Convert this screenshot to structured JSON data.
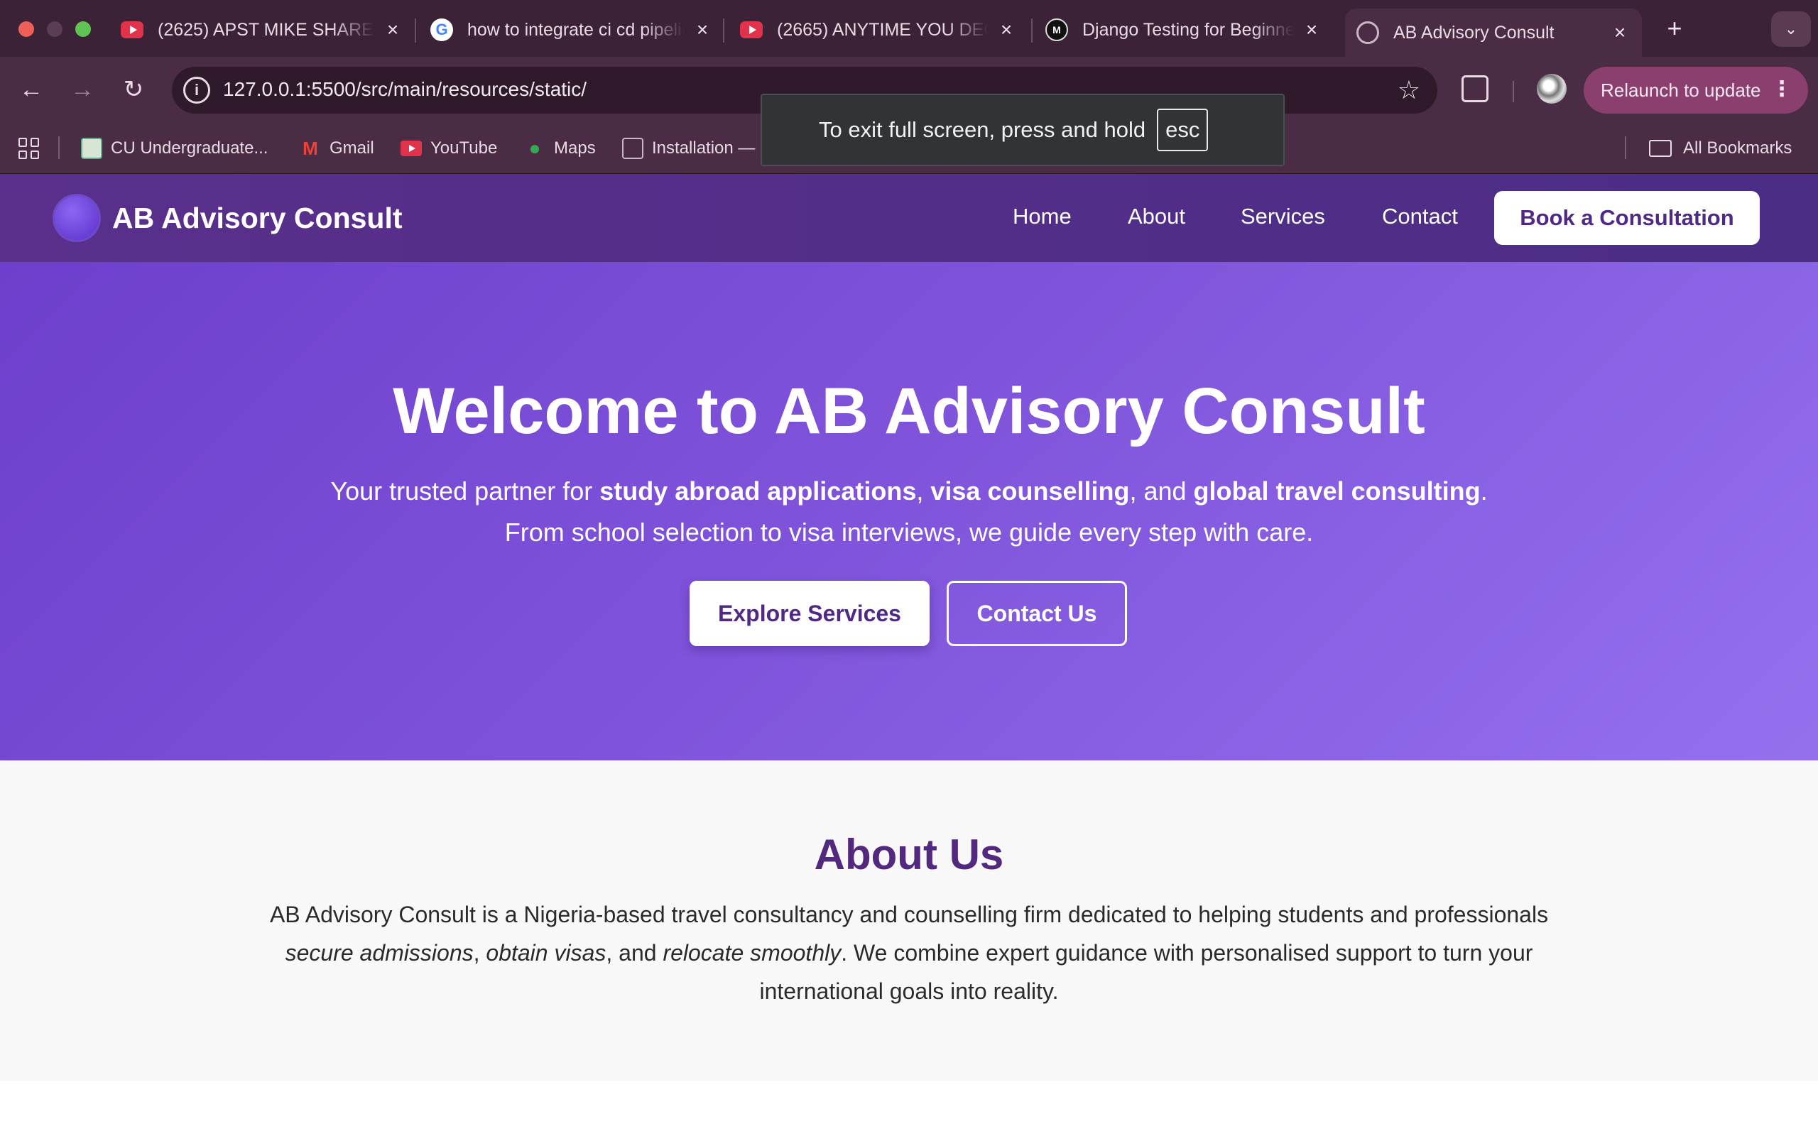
{
  "browser": {
    "tabs": [
      {
        "title": "(2625) APST MIKE SHARES",
        "icon": "youtube-icon"
      },
      {
        "title": "how to integrate ci cd pipeline",
        "icon": "google-icon"
      },
      {
        "title": "(2665) ANYTIME YOU DECIDE",
        "icon": "youtube-icon"
      },
      {
        "title": "Django Testing for Beginners",
        "icon": "medium-icon"
      },
      {
        "title": "AB Advisory Consult",
        "icon": "globe-icon",
        "active": true
      }
    ],
    "new_tab": "+",
    "tab_menu": "⌄",
    "url": "127.0.0.1:5500/src/main/resources/static/",
    "relaunch_label": "Relaunch to update",
    "bookmarks": [
      "CU Undergraduate...",
      "Gmail",
      "YouTube",
      "Maps",
      "Installation —"
    ],
    "all_bookmarks": "All Bookmarks",
    "fullscreen_notice": "To exit full screen, press and hold",
    "fullscreen_key": "esc"
  },
  "site": {
    "brand": "AB Advisory Consult",
    "nav": [
      "Home",
      "About",
      "Services",
      "Contact"
    ],
    "cta": "Book a Consultation",
    "accent": "#4e2a86"
  },
  "hero": {
    "title": "Welcome to AB Advisory Consult",
    "sub_prefix": "Your trusted partner for ",
    "sub_b1": "study abroad applications",
    "sub_sep1": ", ",
    "sub_b2": "visa counselling",
    "sub_sep2": ", and ",
    "sub_b3": "global travel consulting",
    "sub_end": ".",
    "sub_line2": "From school selection to visa interviews, we guide every step with care.",
    "btn_explore": "Explore Services",
    "btn_contact": "Contact Us"
  },
  "about": {
    "title": "About Us",
    "p1": "AB Advisory Consult is a Nigeria-based travel consultancy and counselling firm dedicated to helping students and professionals ",
    "i1": "secure admissions",
    "p2": ", ",
    "i2": "obtain visas",
    "p3": ", and ",
    "i3": "relocate smoothly",
    "p4": ". We combine expert guidance with personalised support to turn your international goals into reality."
  }
}
